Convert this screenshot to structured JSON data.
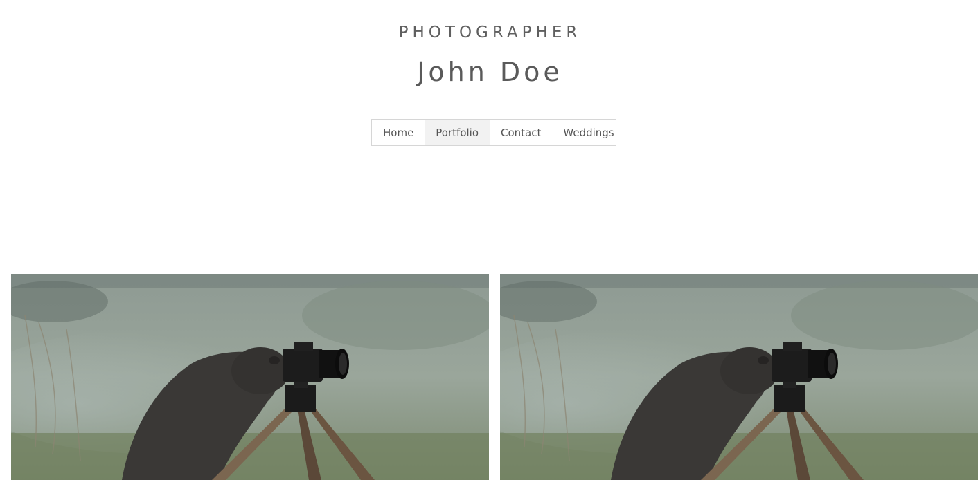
{
  "header": {
    "subtitle": "PHOTOGRAPHER",
    "title": "John Doe"
  },
  "nav": {
    "items": [
      {
        "label": "Home",
        "active": false
      },
      {
        "label": "Portfolio",
        "active": true
      },
      {
        "label": "Contact",
        "active": false
      },
      {
        "label": "Weddings",
        "active": false
      }
    ]
  },
  "gallery": {
    "photos": [
      {
        "subject": "beaver-with-camera-on-tripod"
      },
      {
        "subject": "beaver-with-camera-on-tripod"
      }
    ]
  },
  "colors": {
    "text": "#555555",
    "nav_border": "#d6d6d6",
    "nav_active_bg": "#f2f2f2",
    "background": "#ffffff"
  }
}
